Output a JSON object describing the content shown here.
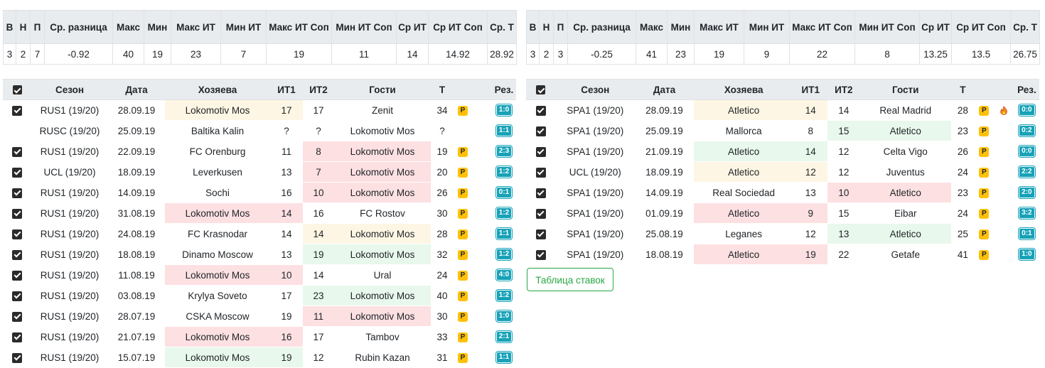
{
  "stats_headers": [
    "В",
    "Н",
    "П",
    "Ср. разница",
    "Макс",
    "Мин",
    "Макс ИТ",
    "Мин ИТ",
    "Макс ИТ Соп",
    "Мин ИТ Соп",
    "Ср ИТ",
    "Ср ИТ Соп",
    "Ср. Т"
  ],
  "left_stats": [
    "3",
    "2",
    "7",
    "-0.92",
    "40",
    "19",
    "23",
    "7",
    "19",
    "11",
    "14",
    "14.92",
    "28.92"
  ],
  "right_stats": [
    "3",
    "2",
    "3",
    "-0.25",
    "41",
    "23",
    "19",
    "9",
    "22",
    "8",
    "13.25",
    "13.5",
    "26.75"
  ],
  "match_headers": {
    "season": "Сезон",
    "date": "Дата",
    "home": "Хозяева",
    "it1": "ИТ1",
    "it2": "ИТ2",
    "away": "Гости",
    "total": "Т",
    "result": "Рез."
  },
  "colors": {
    "win": "#e8f8ec",
    "loss": "#fde0e2",
    "draw": "#fef6e4",
    "p_badge": "#ffc107",
    "result_badge": "#17a2b8",
    "button": "#28a745"
  },
  "left_matches": [
    {
      "checked": true,
      "season": "RUS1 (19/20)",
      "date": "28.09.19",
      "home": "Lokomotiv Mos",
      "it1": "17",
      "it2": "17",
      "away": "Zenit",
      "total": "34",
      "p": "P",
      "result": "1:0",
      "hl": "home",
      "hl_type": "draw",
      "fire": false
    },
    {
      "checked": false,
      "season": "RUSC (19/20)",
      "date": "25.09.19",
      "home": "Baltika Kalin",
      "it1": "?",
      "it2": "?",
      "away": "Lokomotiv Mos",
      "total": "?",
      "p": "",
      "result": "1:1",
      "hl": "",
      "hl_type": "",
      "fire": false
    },
    {
      "checked": true,
      "season": "RUS1 (19/20)",
      "date": "22.09.19",
      "home": "FC Orenburg",
      "it1": "11",
      "it2": "8",
      "away": "Lokomotiv Mos",
      "total": "19",
      "p": "P",
      "result": "2:3",
      "hl": "away",
      "hl_type": "loss",
      "fire": false
    },
    {
      "checked": true,
      "season": "UCL (19/20)",
      "date": "18.09.19",
      "home": "Leverkusen",
      "it1": "13",
      "it2": "7",
      "away": "Lokomotiv Mos",
      "total": "20",
      "p": "P",
      "result": "1:2",
      "hl": "away",
      "hl_type": "loss",
      "fire": false
    },
    {
      "checked": true,
      "season": "RUS1 (19/20)",
      "date": "14.09.19",
      "home": "Sochi",
      "it1": "16",
      "it2": "10",
      "away": "Lokomotiv Mos",
      "total": "26",
      "p": "P",
      "result": "0:1",
      "hl": "away",
      "hl_type": "loss",
      "fire": false
    },
    {
      "checked": true,
      "season": "RUS1 (19/20)",
      "date": "31.08.19",
      "home": "Lokomotiv Mos",
      "it1": "14",
      "it2": "16",
      "away": "FC Rostov",
      "total": "30",
      "p": "P",
      "result": "1:2",
      "hl": "home",
      "hl_type": "loss",
      "fire": false
    },
    {
      "checked": true,
      "season": "RUS1 (19/20)",
      "date": "24.08.19",
      "home": "FC Krasnodar",
      "it1": "14",
      "it2": "14",
      "away": "Lokomotiv Mos",
      "total": "28",
      "p": "P",
      "result": "1:1",
      "hl": "away",
      "hl_type": "draw",
      "fire": false
    },
    {
      "checked": true,
      "season": "RUS1 (19/20)",
      "date": "18.08.19",
      "home": "Dinamo Moscow",
      "it1": "13",
      "it2": "19",
      "away": "Lokomotiv Mos",
      "total": "32",
      "p": "P",
      "result": "1:2",
      "hl": "away",
      "hl_type": "win",
      "fire": false
    },
    {
      "checked": true,
      "season": "RUS1 (19/20)",
      "date": "11.08.19",
      "home": "Lokomotiv Mos",
      "it1": "10",
      "it2": "14",
      "away": "Ural",
      "total": "24",
      "p": "P",
      "result": "4:0",
      "hl": "home",
      "hl_type": "loss",
      "fire": false
    },
    {
      "checked": true,
      "season": "RUS1 (19/20)",
      "date": "03.08.19",
      "home": "Krylya Soveto",
      "it1": "17",
      "it2": "23",
      "away": "Lokomotiv Mos",
      "total": "40",
      "p": "P",
      "result": "1:2",
      "hl": "away",
      "hl_type": "win",
      "fire": false
    },
    {
      "checked": true,
      "season": "RUS1 (19/20)",
      "date": "28.07.19",
      "home": "CSKA Moscow",
      "it1": "19",
      "it2": "11",
      "away": "Lokomotiv Mos",
      "total": "30",
      "p": "P",
      "result": "1:0",
      "hl": "away",
      "hl_type": "loss",
      "fire": false
    },
    {
      "checked": true,
      "season": "RUS1 (19/20)",
      "date": "21.07.19",
      "home": "Lokomotiv Mos",
      "it1": "16",
      "it2": "17",
      "away": "Tambov",
      "total": "33",
      "p": "P",
      "result": "2:1",
      "hl": "home",
      "hl_type": "loss",
      "fire": false
    },
    {
      "checked": true,
      "season": "RUS1 (19/20)",
      "date": "15.07.19",
      "home": "Lokomotiv Mos",
      "it1": "19",
      "it2": "12",
      "away": "Rubin Kazan",
      "total": "31",
      "p": "P",
      "result": "1:1",
      "hl": "home",
      "hl_type": "win",
      "fire": false
    }
  ],
  "right_matches": [
    {
      "checked": true,
      "season": "SPA1 (19/20)",
      "date": "28.09.19",
      "home": "Atletico",
      "it1": "14",
      "it2": "14",
      "away": "Real Madrid",
      "total": "28",
      "p": "P",
      "result": "0:0",
      "hl": "home",
      "hl_type": "draw",
      "fire": true
    },
    {
      "checked": true,
      "season": "SPA1 (19/20)",
      "date": "25.09.19",
      "home": "Mallorca",
      "it1": "8",
      "it2": "15",
      "away": "Atletico",
      "total": "23",
      "p": "P",
      "result": "0:2",
      "hl": "away",
      "hl_type": "win",
      "fire": false
    },
    {
      "checked": true,
      "season": "SPA1 (19/20)",
      "date": "21.09.19",
      "home": "Atletico",
      "it1": "14",
      "it2": "12",
      "away": "Celta Vigo",
      "total": "26",
      "p": "P",
      "result": "0:0",
      "hl": "home",
      "hl_type": "win",
      "fire": false
    },
    {
      "checked": true,
      "season": "UCL (19/20)",
      "date": "18.09.19",
      "home": "Atletico",
      "it1": "12",
      "it2": "12",
      "away": "Juventus",
      "total": "24",
      "p": "P",
      "result": "2:2",
      "hl": "home",
      "hl_type": "draw",
      "fire": false
    },
    {
      "checked": true,
      "season": "SPA1 (19/20)",
      "date": "14.09.19",
      "home": "Real Sociedad",
      "it1": "13",
      "it2": "10",
      "away": "Atletico",
      "total": "23",
      "p": "P",
      "result": "2:0",
      "hl": "away",
      "hl_type": "loss",
      "fire": false
    },
    {
      "checked": true,
      "season": "SPA1 (19/20)",
      "date": "01.09.19",
      "home": "Atletico",
      "it1": "9",
      "it2": "15",
      "away": "Eibar",
      "total": "24",
      "p": "P",
      "result": "3:2",
      "hl": "home",
      "hl_type": "loss",
      "fire": false
    },
    {
      "checked": true,
      "season": "SPA1 (19/20)",
      "date": "25.08.19",
      "home": "Leganes",
      "it1": "12",
      "it2": "13",
      "away": "Atletico",
      "total": "25",
      "p": "P",
      "result": "0:1",
      "hl": "away",
      "hl_type": "win",
      "fire": false
    },
    {
      "checked": true,
      "season": "SPA1 (19/20)",
      "date": "18.08.19",
      "home": "Atletico",
      "it1": "19",
      "it2": "22",
      "away": "Getafe",
      "total": "41",
      "p": "P",
      "result": "1:0",
      "hl": "home",
      "hl_type": "loss",
      "fire": false
    }
  ],
  "bets_button_label": "Таблица ставок"
}
